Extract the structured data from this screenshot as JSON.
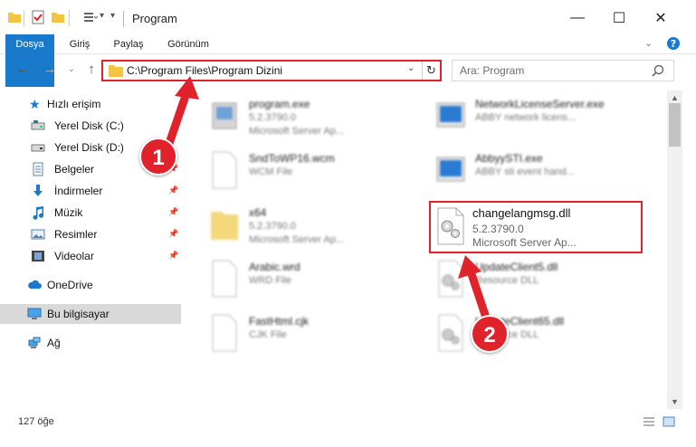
{
  "window": {
    "title": "Program",
    "minimize": "—",
    "maximize": "☐",
    "close": "✕"
  },
  "ribbon": {
    "tabs": [
      "Dosya",
      "Giriş",
      "Paylaş",
      "Görünüm"
    ]
  },
  "address": {
    "path": "C:\\Program Files\\Program Dizini"
  },
  "search": {
    "placeholder": "Ara: Program"
  },
  "sidebar": {
    "quick_access": "Hızlı erişim",
    "items": [
      {
        "label": "Yerel Disk (C:)",
        "icon": "drive-icon",
        "pinned": true
      },
      {
        "label": "Yerel Disk (D:)",
        "icon": "drive-icon",
        "pinned": true
      },
      {
        "label": "Belgeler",
        "icon": "documents-icon",
        "pinned": true
      },
      {
        "label": "İndirmeler",
        "icon": "downloads-icon",
        "pinned": true
      },
      {
        "label": "Müzik",
        "icon": "music-icon",
        "pinned": true
      },
      {
        "label": "Resimler",
        "icon": "pictures-icon",
        "pinned": true
      },
      {
        "label": "Videolar",
        "icon": "videos-icon",
        "pinned": true
      }
    ],
    "onedrive": "OneDrive",
    "this_pc": "Bu bilgisayar",
    "network": "Ağ"
  },
  "files": {
    "left": [
      {
        "name": "program.exe",
        "l2": "5.2.3790.0",
        "l3": "Microsoft Server Ap..."
      },
      {
        "name": "SndToWP16.wcm",
        "l2": "WCM File",
        "l3": ""
      },
      {
        "name": "x64",
        "l2": "5.2.3790.0",
        "l3": "Microsoft Server Ap..."
      },
      {
        "name": "Arabic.wrd",
        "l2": "WRD File",
        "l3": ""
      },
      {
        "name": "FastHtml.cjk",
        "l2": "CJK File",
        "l3": ""
      }
    ],
    "right": [
      {
        "name": "NetworkLicenseServer.exe",
        "l2": "ABBY network licens...",
        "l3": ""
      },
      {
        "name": "AbbyySTI.exe",
        "l2": "ABBY sti event hand...",
        "l3": ""
      },
      {
        "name": "UpdateClient5.dll",
        "l2": "Resource DLL",
        "l3": ""
      },
      {
        "name": "UpdateClient65.dll",
        "l2": "Resource DLL",
        "l3": ""
      }
    ],
    "highlighted": {
      "name": "changelangmsg.dll",
      "l2": "5.2.3790.0",
      "l3": "Microsoft Server Ap..."
    }
  },
  "status": {
    "count": "127 öğe"
  },
  "annotations": {
    "step1": "1",
    "step2": "2",
    "color": "#e0232b"
  }
}
